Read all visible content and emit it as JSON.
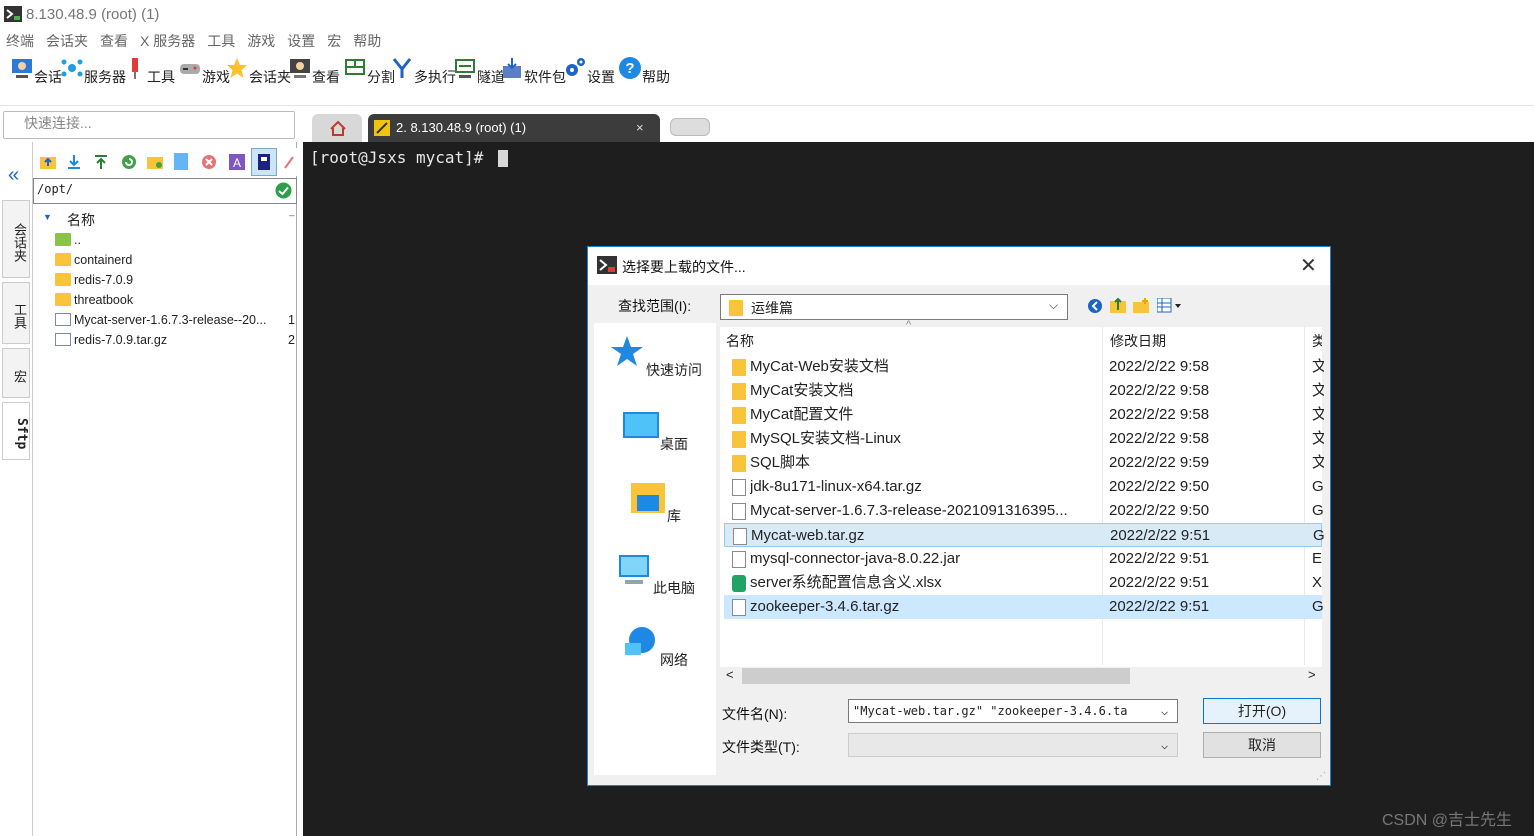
{
  "window": {
    "title": "8.130.48.9 (root) (1)"
  },
  "menu": [
    "终端",
    "会话夹",
    "查看",
    "X 服务器",
    "工具",
    "游戏",
    "设置",
    "宏",
    "帮助"
  ],
  "toolbar": [
    {
      "label": "会话",
      "icon": "session-icon"
    },
    {
      "label": "服务器",
      "icon": "servers-icon"
    },
    {
      "label": "工具",
      "icon": "tools-icon"
    },
    {
      "label": "游戏",
      "icon": "games-icon"
    },
    {
      "label": "会话夹",
      "icon": "star-icon"
    },
    {
      "label": "查看",
      "icon": "view-icon"
    },
    {
      "label": "分割",
      "icon": "split-icon"
    },
    {
      "label": "多执行",
      "icon": "multiexec-icon"
    },
    {
      "label": "隧道",
      "icon": "tunnel-icon"
    },
    {
      "label": "软件包",
      "icon": "packages-icon"
    },
    {
      "label": "设置",
      "icon": "settings-icon"
    },
    {
      "label": "帮助",
      "icon": "help-icon"
    }
  ],
  "quick_connect": {
    "placeholder": "快速连接..."
  },
  "tabs": {
    "active": "2. 8.130.48.9 (root) (1)",
    "close": "×"
  },
  "side_tabs": [
    "会话夹",
    "工具",
    "宏",
    "Sftp"
  ],
  "sftp": {
    "path": "/opt/",
    "header_name": "名称",
    "rows": [
      {
        "name": "..",
        "type": "up",
        "size": ""
      },
      {
        "name": "containerd",
        "type": "folder",
        "size": ""
      },
      {
        "name": "redis-7.0.9",
        "type": "folder",
        "size": ""
      },
      {
        "name": "threatbook",
        "type": "folder",
        "size": ""
      },
      {
        "name": "Mycat-server-1.6.7.3-release--20...",
        "type": "file",
        "size": "1"
      },
      {
        "name": "redis-7.0.9.tar.gz",
        "type": "file",
        "size": "2"
      }
    ]
  },
  "terminal": {
    "prompt": "[root@Jsxs mycat]#"
  },
  "dialog": {
    "title": "选择要上载的文件...",
    "close": "✕",
    "lookin_label": "查找范围(I):",
    "lookin_value": "运维篇",
    "places": [
      "快速访问",
      "桌面",
      "库",
      "此电脑",
      "网络"
    ],
    "columns": {
      "name": "名称",
      "date": "修改日期",
      "type": "类"
    },
    "files": [
      {
        "name": "MyCat-Web安装文档",
        "date": "2022/2/22 9:58",
        "type": "文",
        "kind": "folder"
      },
      {
        "name": "MyCat安装文档",
        "date": "2022/2/22 9:58",
        "type": "文",
        "kind": "folder"
      },
      {
        "name": "MyCat配置文件",
        "date": "2022/2/22 9:58",
        "type": "文",
        "kind": "folder"
      },
      {
        "name": "MySQL安装文档-Linux",
        "date": "2022/2/22 9:58",
        "type": "文",
        "kind": "folder"
      },
      {
        "name": "SQL脚本",
        "date": "2022/2/22 9:59",
        "type": "文",
        "kind": "folder"
      },
      {
        "name": "jdk-8u171-linux-x64.tar.gz",
        "date": "2022/2/22 9:50",
        "type": "G",
        "kind": "file"
      },
      {
        "name": "Mycat-server-1.6.7.3-release-2021091316395...",
        "date": "2022/2/22 9:50",
        "type": "G",
        "kind": "file"
      },
      {
        "name": "Mycat-web.tar.gz",
        "date": "2022/2/22 9:51",
        "type": "G",
        "kind": "file",
        "selected": "focus"
      },
      {
        "name": "mysql-connector-java-8.0.22.jar",
        "date": "2022/2/22 9:51",
        "type": "E",
        "kind": "file"
      },
      {
        "name": "server系统配置信息含义.xlsx",
        "date": "2022/2/22 9:51",
        "type": "X",
        "kind": "xlsx"
      },
      {
        "name": "zookeeper-3.4.6.tar.gz",
        "date": "2022/2/22 9:51",
        "type": "G",
        "kind": "file",
        "selected": "sel"
      }
    ],
    "filename_label": "文件名(N):",
    "filename_value": "\"Mycat-web.tar.gz\" \"zookeeper-3.4.6.ta",
    "filetype_label": "文件类型(T):",
    "filetype_value": "",
    "open_button": "打开(O)",
    "cancel_button": "取消"
  },
  "watermark": "CSDN @吉士先生"
}
